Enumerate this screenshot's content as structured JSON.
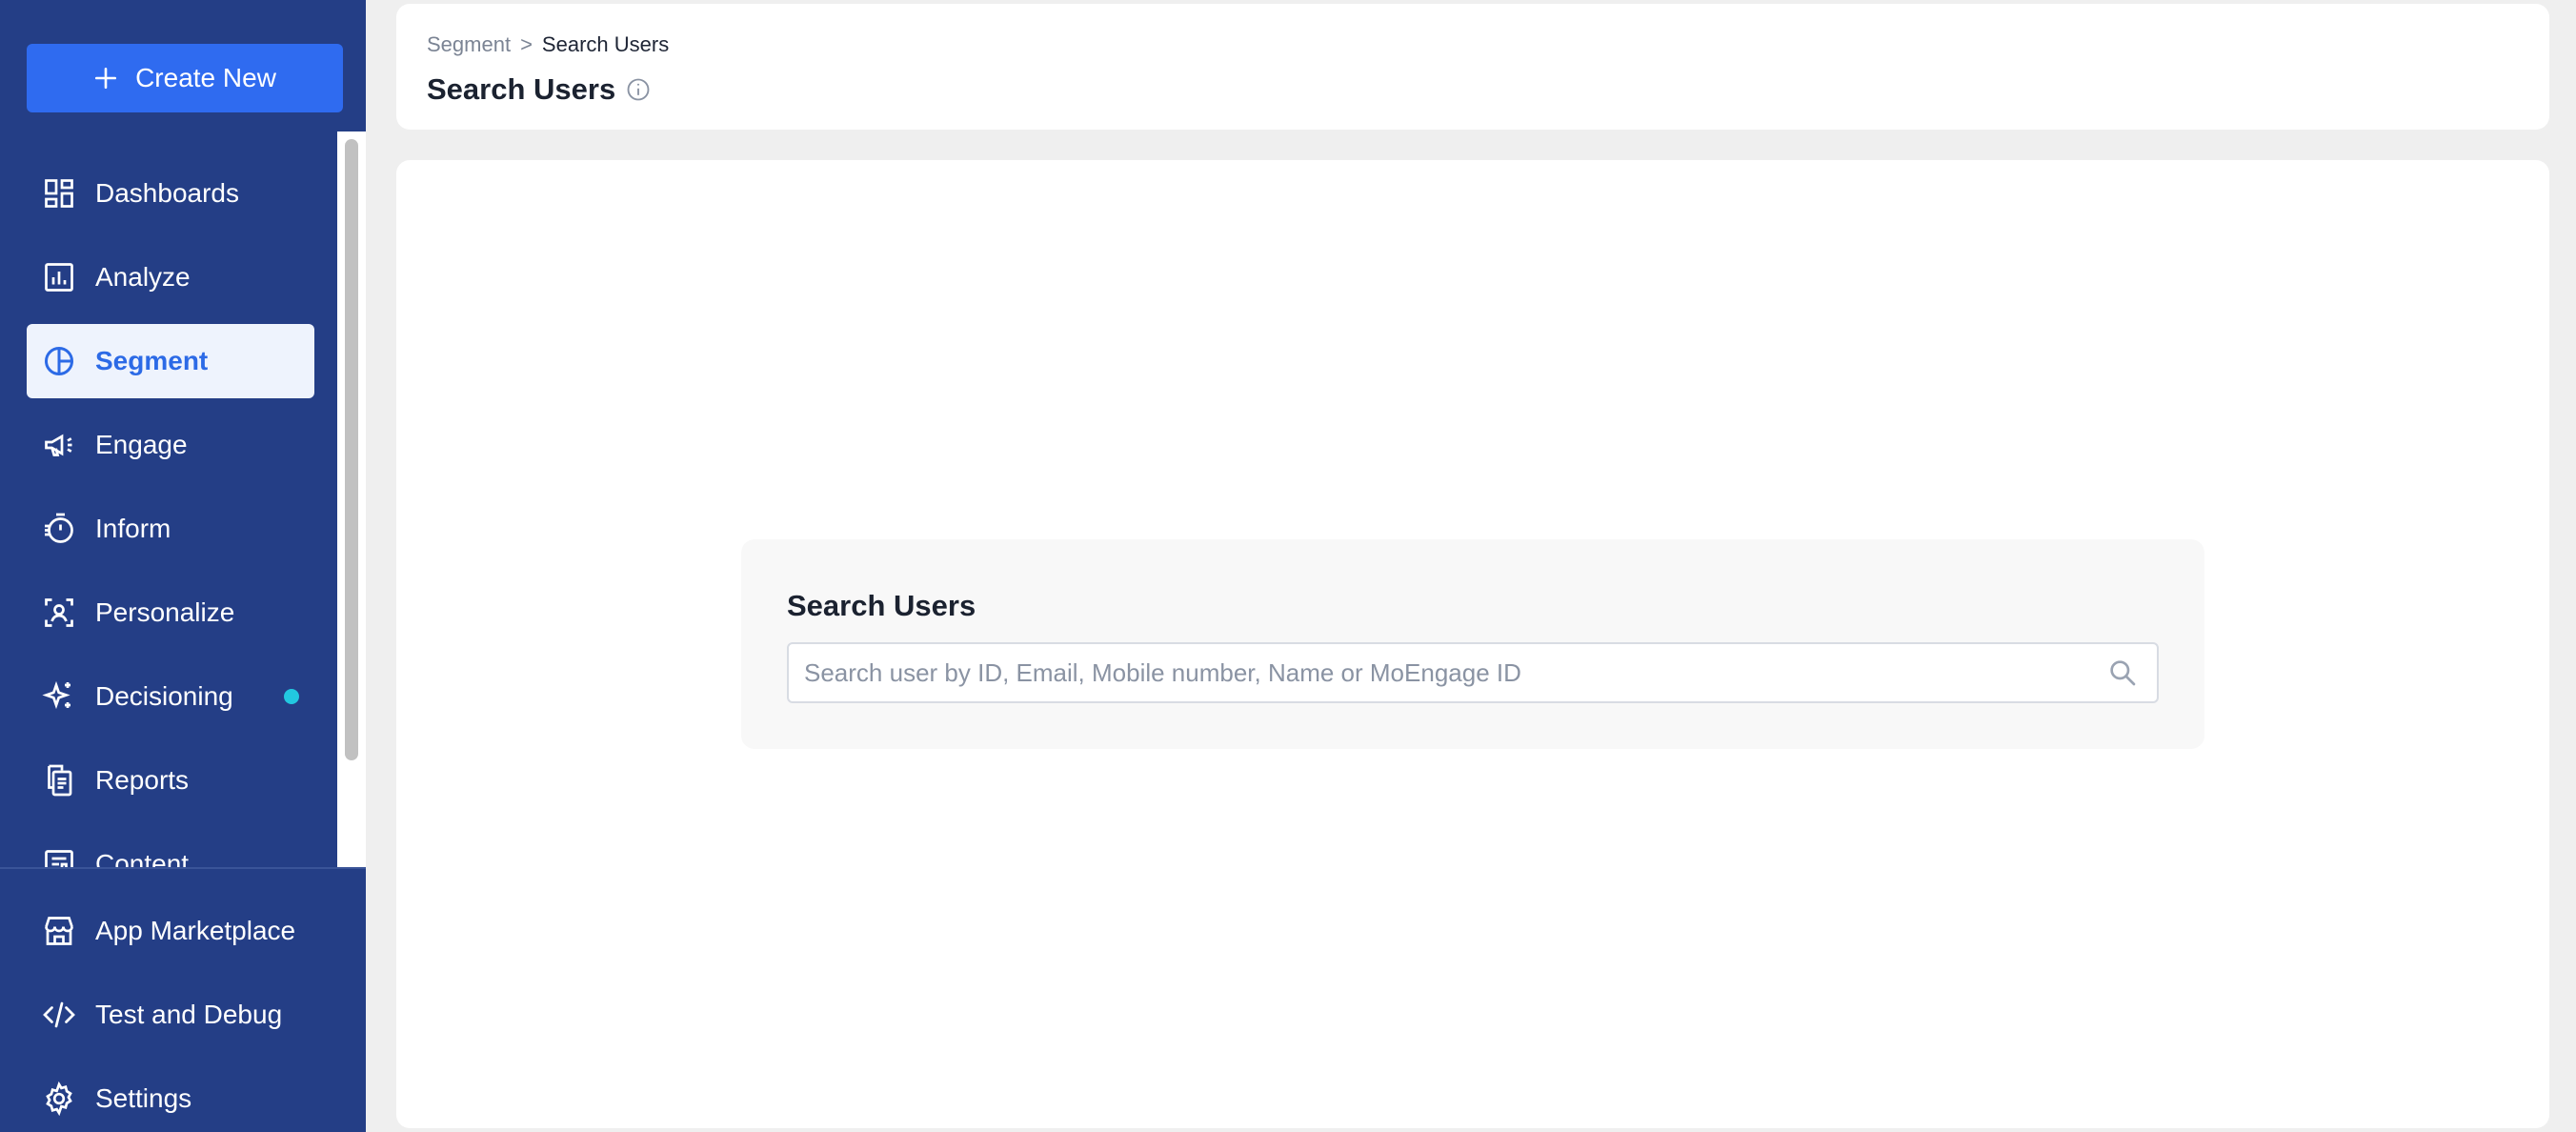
{
  "sidebar": {
    "create_label": "Create New",
    "nav_items": [
      {
        "label": "Dashboards",
        "icon": "dashboard-icon"
      },
      {
        "label": "Analyze",
        "icon": "bar-chart-icon"
      },
      {
        "label": "Segment",
        "icon": "pie-chart-icon",
        "active": true
      },
      {
        "label": "Engage",
        "icon": "megaphone-icon"
      },
      {
        "label": "Inform",
        "icon": "stopwatch-icon"
      },
      {
        "label": "Personalize",
        "icon": "user-frame-icon"
      },
      {
        "label": "Decisioning",
        "icon": "sparkle-icon",
        "badge": "new-dot"
      },
      {
        "label": "Reports",
        "icon": "report-icon"
      },
      {
        "label": "Content",
        "icon": "content-icon"
      }
    ],
    "bottom_items": [
      {
        "label": "App Marketplace",
        "icon": "store-icon"
      },
      {
        "label": "Test and Debug",
        "icon": "code-icon"
      },
      {
        "label": "Settings",
        "icon": "gear-icon"
      }
    ]
  },
  "header": {
    "breadcrumb": [
      "Segment",
      "Search Users"
    ],
    "breadcrumb_separator": ">",
    "title": "Search Users"
  },
  "search": {
    "title": "Search Users",
    "placeholder": "Search user by ID, Email, Mobile number, Name or MoEngage ID",
    "value": ""
  },
  "colors": {
    "sidebar_bg": "#243e86",
    "accent": "#2f6bf0",
    "active_bg": "#eef3fd",
    "active_text": "#2c6ae6",
    "badge": "#22c8e0"
  }
}
